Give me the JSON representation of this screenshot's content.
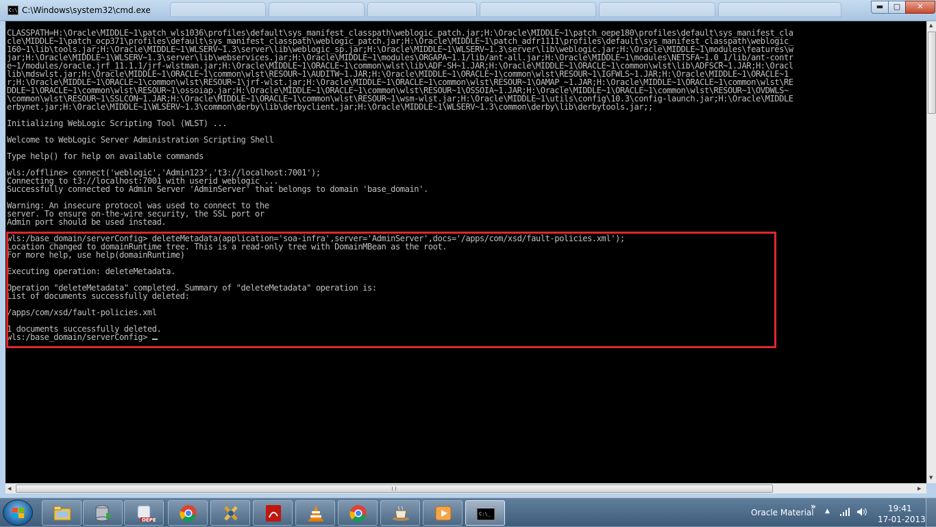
{
  "window": {
    "title": "C:\\Windows\\system32\\cmd.exe",
    "icon_text": "C:\\",
    "buttons": {
      "minimize": "▬",
      "maximize": "□",
      "close": "✕"
    }
  },
  "console": {
    "lines": [
      "CLASSPATH=H:\\Oracle\\MIDDLE~1\\patch_wls1036\\profiles\\default\\sys_manifest_classpath\\weblogic_patch.jar;H:\\Oracle\\MIDDLE~1\\patch_oepe180\\profiles\\default\\sys_manifest_cla",
      "cle\\MIDDLE~1\\patch_ocp371\\profiles\\default\\sys_manifest_classpath\\weblogic_patch.jar;H:\\Oracle\\MIDDLE~1\\patch_adfr1111\\profiles\\default\\sys_manifest_classpath\\weblogic_",
      "160~1\\lib\\tools.jar;H:\\Oracle\\MIDDLE~1\\WLSERV~1.3\\server\\lib\\weblogic_sp.jar;H:\\Oracle\\MIDDLE~1\\WLSERV~1.3\\server\\lib\\weblogic.jar;H:\\Oracle\\MIDDLE~1\\modules\\features\\w",
      "jar;H:\\Oracle\\MIDDLE~1\\WLSERV~1.3\\server\\lib\\webservices.jar;H:\\Oracle\\MIDDLE~1\\modules\\ORGAPA~1.1/lib/ant-all.jar;H:\\Oracle\\MIDDLE~1\\modules\\NETSFA~1.0_1/lib/ant-contr",
      "e~1/modules/oracle.jrf_11.1.1/jrf-wlstman.jar;H:\\Oracle\\MIDDLE~1\\ORACLE~1\\common\\wlst\\lib\\ADF-SH~1.JAR;H:\\Oracle\\MIDDLE~1\\ORACLE~1\\common\\wlst\\lib\\ADFSCR~1.JAR;H:\\Oracl",
      "lib\\mdswlst.jar;H:\\Oracle\\MIDDLE~1\\ORACLE~1\\common\\wlst\\RESOUR~1\\AUDITW~1.JAR;H:\\Oracle\\MIDDLE~1\\ORACLE~1\\common\\wlst\\RESOUR~1\\IGFWLS~1.JAR;H:\\Oracle\\MIDDLE~1\\ORACLE~1",
      "r;H:\\Oracle\\MIDDLE~1\\ORACLE~1\\common\\wlst\\RESOUR~1\\jrf-wlst.jar;H:\\Oracle\\MIDDLE~1\\ORACLE~1\\common\\wlst\\RESOUR~1\\OAMAP_~1.JAR;H:\\Oracle\\MIDDLE~1\\ORACLE~1\\common\\wlst\\RE",
      "DDLE~1\\ORACLE~1\\common\\wlst\\RESOUR~1\\ossoiap.jar;H:\\Oracle\\MIDDLE~1\\ORACLE~1\\common\\wlst\\RESOUR~1\\OSSOIA~1.JAR;H:\\Oracle\\MIDDLE~1\\ORACLE~1\\common\\wlst\\RESOUR~1\\OVDWLS~",
      "\\common\\wlst\\RESOUR~1\\SSLCON~1.JAR;H:\\Oracle\\MIDDLE~1\\ORACLE~1\\common\\wlst\\RESOUR~1\\wsm-wlst.jar;H:\\Oracle\\MIDDLE~1\\utils\\config\\10.3\\config-launch.jar;H:\\Oracle\\MIDDLE",
      "erbynet.jar;H:\\Oracle\\MIDDLE~1\\WLSERV~1.3\\common\\derby\\lib\\derbyclient.jar;H:\\Oracle\\MIDDLE~1\\WLSERV~1.3\\common\\derby\\lib\\derbytools.jar;;",
      "",
      "Initializing WebLogic Scripting Tool (WLST) ...",
      "",
      "Welcome to WebLogic Server Administration Scripting Shell",
      "",
      "Type help() for help on available commands",
      "",
      "wls:/offline> connect('weblogic','Admin123','t3://localhost:7001');",
      "Connecting to t3://localhost:7001 with userid weblogic ...",
      "Successfully connected to Admin Server 'AdminServer' that belongs to domain 'base_domain'.",
      "",
      "Warning: An insecure protocol was used to connect to the",
      "server. To ensure on-the-wire security, the SSL port or",
      "Admin port should be used instead.",
      "",
      "wls:/base_domain/serverConfig> deleteMetadata(application='soa-infra',server='AdminServer',docs='/apps/com/xsd/fault-policies.xml');",
      "Location changed to domainRuntime tree. This is a read-only tree with DomainMBean as the root.",
      "For more help, use help(domainRuntime)",
      "",
      "Executing operation: deleteMetadata.",
      "",
      "Operation \"deleteMetadata\" completed. Summary of \"deleteMetadata\" operation is:",
      "List of documents successfully deleted:",
      "",
      "/apps/com/xsd/fault-policies.xml",
      "",
      "1 documents successfully deleted."
    ],
    "prompt": "wls:/base_domain/serverConfig> "
  },
  "taskbar": {
    "apps": [
      {
        "name": "windows-explorer",
        "active": false
      },
      {
        "name": "database-tool",
        "active": false
      },
      {
        "name": "oepe",
        "active": false
      },
      {
        "name": "google-chrome",
        "active": false
      },
      {
        "name": "tools",
        "active": false
      },
      {
        "name": "adobe-reader",
        "active": false
      },
      {
        "name": "vlc-player",
        "active": false
      },
      {
        "name": "google-chrome-2",
        "active": false
      },
      {
        "name": "coffee-cup",
        "active": false
      },
      {
        "name": "media-player",
        "active": false
      },
      {
        "name": "command-prompt",
        "active": true
      }
    ],
    "oepe_label": "OEPE",
    "tray_label": "Oracle Material",
    "tray_chevron": "»",
    "tray_up": "▲",
    "clock_time": "19:41",
    "clock_date": "17-01-2013"
  },
  "colors": {
    "console_bg": "#000000",
    "console_text": "#c0c0c0",
    "highlight_border": "#e3262b",
    "taskbar": "#4f6e8c"
  }
}
